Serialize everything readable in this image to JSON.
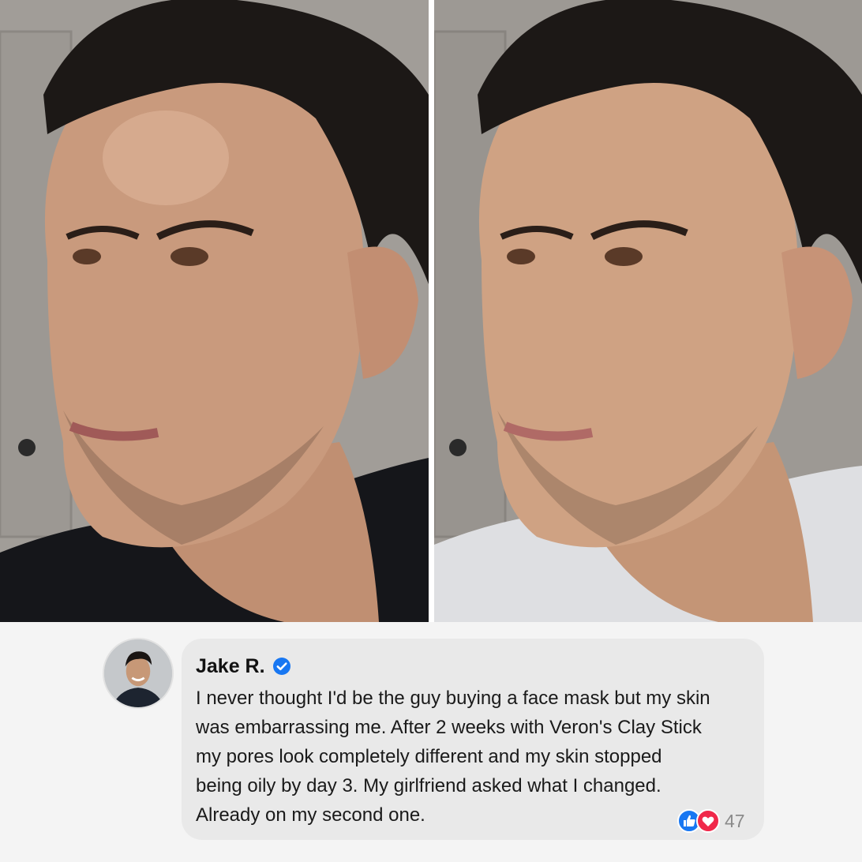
{
  "photos": {
    "before": {
      "icon": "before-face-photo"
    },
    "after": {
      "icon": "after-face-photo"
    }
  },
  "comment": {
    "author": "Jake R.",
    "verified_icon": "verified-badge-icon",
    "lines": [
      "I never thought I'd be the guy buying a face mask but my skin",
      "was embarrassing me. After 2 weeks with Veron's Clay Stick",
      "my pores look completely different and my skin stopped",
      "being oily by day 3. My girlfriend asked what I changed.",
      "Already on my second one."
    ],
    "reactions": {
      "icons": [
        "like-icon",
        "love-icon"
      ],
      "count": "47"
    }
  },
  "colors": {
    "verified": "#1877f2",
    "like": "#1877f2",
    "love": "#f0284a",
    "bubble": "#e9e9e9"
  }
}
